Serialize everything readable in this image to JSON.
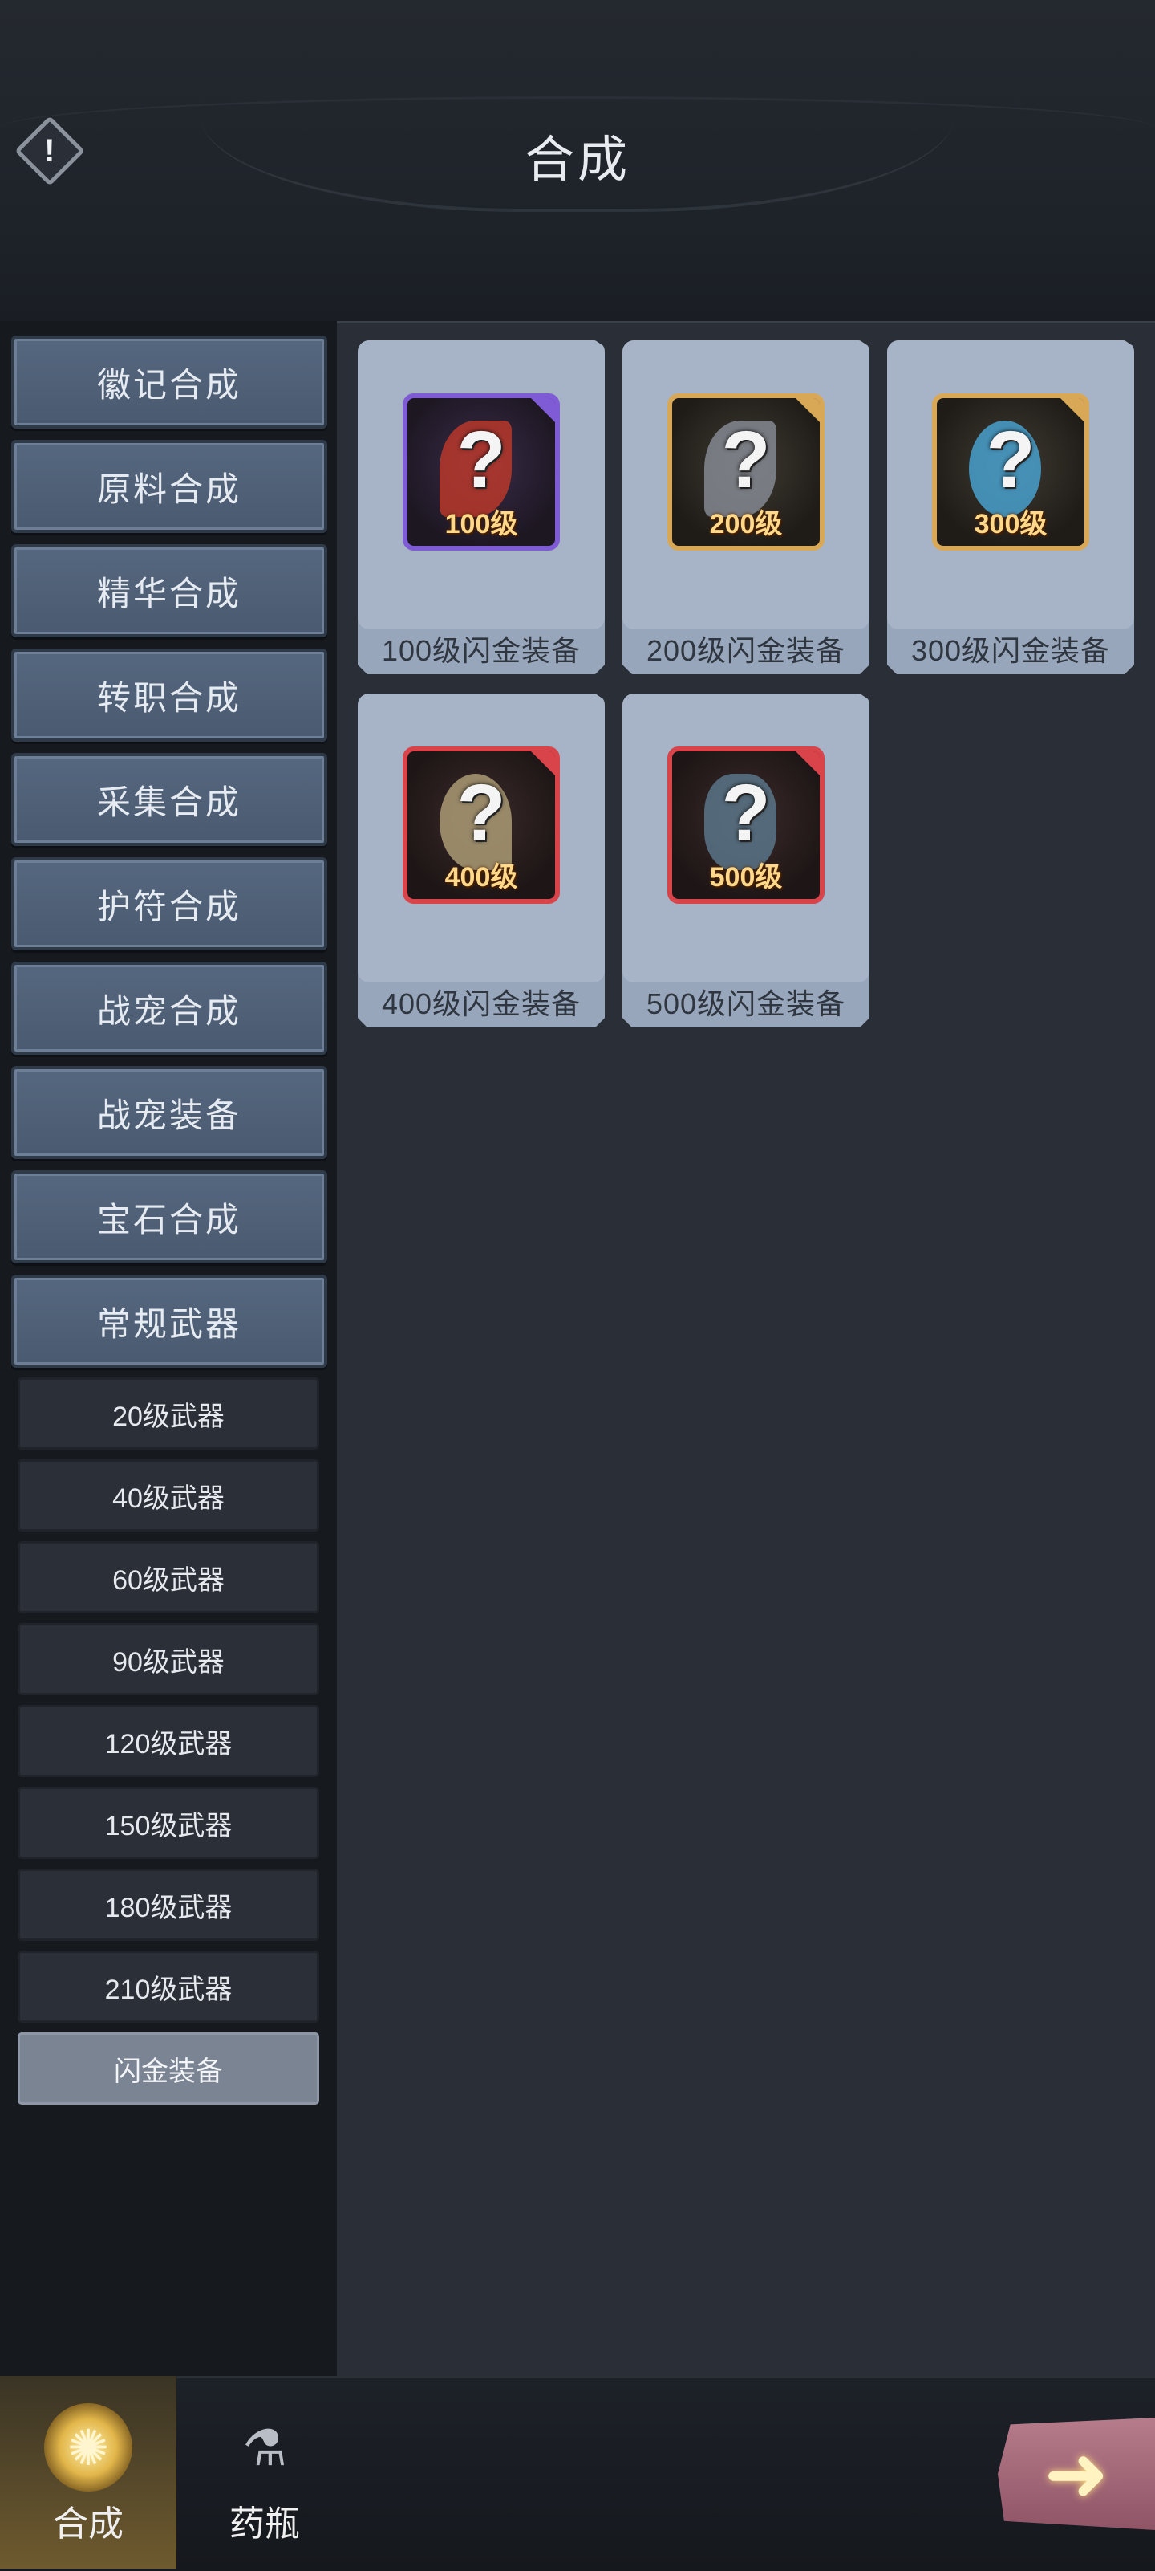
{
  "header": {
    "title": "合成",
    "info_icon": "exclamation-icon"
  },
  "sidebar": {
    "categories": [
      {
        "label": "徽记合成"
      },
      {
        "label": "原料合成"
      },
      {
        "label": "精华合成"
      },
      {
        "label": "转职合成"
      },
      {
        "label": "采集合成"
      },
      {
        "label": "护符合成"
      },
      {
        "label": "战宠合成"
      },
      {
        "label": "战宠装备"
      },
      {
        "label": "宝石合成"
      },
      {
        "label": "常规武器"
      }
    ],
    "subitems": [
      {
        "label": "20级武器",
        "selected": false
      },
      {
        "label": "40级武器",
        "selected": false
      },
      {
        "label": "60级武器",
        "selected": false
      },
      {
        "label": "90级武器",
        "selected": false
      },
      {
        "label": "120级武器",
        "selected": false
      },
      {
        "label": "150级武器",
        "selected": false
      },
      {
        "label": "180级武器",
        "selected": false
      },
      {
        "label": "210级武器",
        "selected": false
      },
      {
        "label": "闪金装备",
        "selected": true
      }
    ]
  },
  "items": [
    {
      "level_label": "100级",
      "name": "100级闪金装备",
      "frame_color": "#7f5bd6",
      "tint": "#c0392b"
    },
    {
      "level_label": "200级",
      "name": "200级闪金装备",
      "frame_color": "#d9a857",
      "tint": "#8a8f99"
    },
    {
      "level_label": "300级",
      "name": "300级闪金装备",
      "frame_color": "#d9a857",
      "tint": "#4aa7d8"
    },
    {
      "level_label": "400级",
      "name": "400级闪金装备",
      "frame_color": "#d9434a",
      "tint": "#b3a37a"
    },
    {
      "level_label": "500级",
      "name": "500级闪金装备",
      "frame_color": "#d9434a",
      "tint": "#5c7a8f"
    }
  ],
  "question_mark": "?",
  "bottom_nav": {
    "tabs": [
      {
        "label": "合成",
        "icon": "synthesis-icon",
        "active": true
      },
      {
        "label": "药瓶",
        "icon": "potion-bottle-icon",
        "active": false
      }
    ],
    "next_icon": "arrow-right-icon"
  }
}
